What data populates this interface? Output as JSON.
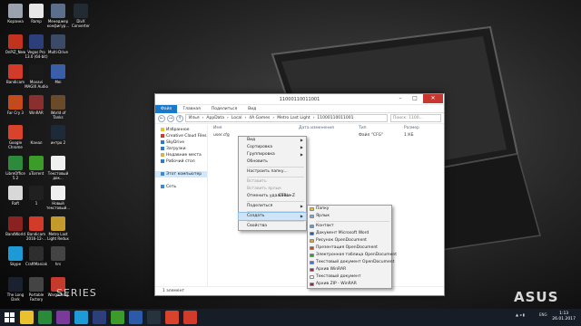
{
  "desktop": {
    "icons": [
      {
        "label": "Корзина",
        "color": "#9aa3ad"
      },
      {
        "label": "Ramp",
        "color": "#e7e7e7"
      },
      {
        "label": "Менеджер конфигур...",
        "color": "#5b6e8a"
      },
      {
        "label": "DivX Converter",
        "color": "#222a33"
      },
      {
        "label": "OnPiZ_New",
        "color": "#c2331f"
      },
      {
        "label": "Vegas Pro 13.0 (64-bit)",
        "color": "#2c3f7a"
      },
      {
        "label": "Multi-Drive",
        "color": "#3b4a66"
      },
      {
        "label": "Bandicam",
        "color": "#d23a2a"
      },
      {
        "label": "Movavi MAGIX Audio",
        "color": "#1a1a1a"
      },
      {
        "label": "Mei",
        "color": "#3a5ea8"
      },
      {
        "label": "Far Cry 3",
        "color": "#c24a1b"
      },
      {
        "label": "WinRAR",
        "color": "#8a2f2f"
      },
      {
        "label": "World of Tanks",
        "color": "#6a4a2a"
      },
      {
        "label": "Google Chrome",
        "color": "#d9432b"
      },
      {
        "label": "Канал",
        "color": "#1a1a1a"
      },
      {
        "label": "интро 2",
        "color": "#1f2a38"
      },
      {
        "label": "LibreOffice 5.2",
        "color": "#2d8a3c"
      },
      {
        "label": "uTorrent",
        "color": "#3b9c2a"
      },
      {
        "label": "Текстовый док...",
        "color": "#f0f0f0"
      },
      {
        "label": "Raft",
        "color": "#d8d8d8"
      },
      {
        "label": "1",
        "color": "#202020"
      },
      {
        "label": "Новый текстовый...",
        "color": "#f0f0f0"
      },
      {
        "label": "Bandicam 2016-12-...",
        "color": "#d23a2a"
      },
      {
        "label": "Metro Last Light Redux",
        "color": "#c49a2c"
      },
      {
        "label": "BandWorld",
        "color": "#8a2222"
      },
      {
        "label": "Skype",
        "color": "#1e9ad6"
      },
      {
        "label": "CraftManiak",
        "color": "#2e2e2e"
      },
      {
        "label": "hrs",
        "color": "#444"
      },
      {
        "label": "The Long Dark",
        "color": "#1a2230"
      },
      {
        "label": "Portable Factory",
        "color": "#444"
      },
      {
        "label": "Wargaming",
        "color": "#c43b2b"
      }
    ],
    "brand": "ASUS",
    "series": "SERIES"
  },
  "explorer": {
    "title": "11000110011001",
    "ribbon_tabs": [
      "Файл",
      "Главная",
      "Поделиться",
      "Вид"
    ],
    "nav": {
      "back": "←",
      "forward": "→",
      "up": "↑"
    },
    "path": [
      "Илья",
      "AppData",
      "Local",
      "4A Games",
      "Metro Last Light",
      "11000110011001"
    ],
    "search_placeholder": "Поиск: 1100...",
    "sidebar": [
      {
        "label": "Избранное",
        "color": "#e8c12c"
      },
      {
        "label": "Creative Cloud Files",
        "color": "#d03a2c"
      },
      {
        "label": "SkyDrive",
        "color": "#2b7bd0"
      },
      {
        "label": "Загрузки",
        "color": "#2b7bd0"
      },
      {
        "label": "Недавние места",
        "color": "#d6b24a"
      },
      {
        "label": "Рабочий стол",
        "color": "#2b7bd0"
      },
      {
        "label": "",
        "color": ""
      },
      {
        "label": "Этот компьютер",
        "color": "#3b8ad8"
      },
      {
        "label": "",
        "color": ""
      },
      {
        "label": "Сеть",
        "color": "#3b8ad8"
      }
    ],
    "columns": [
      "Имя",
      "Дата изменения",
      "Тип",
      "Размер"
    ],
    "files": [
      {
        "name": "user.cfg",
        "date": "",
        "type": "Файл \"CFG\"",
        "size": "1 КБ"
      }
    ],
    "status": "1 элемент"
  },
  "context_menu": {
    "items": [
      {
        "label": "Вид",
        "arrow": true
      },
      {
        "label": "Сортировка",
        "arrow": true
      },
      {
        "label": "Группировка",
        "arrow": true
      },
      {
        "label": "Обновить"
      },
      {
        "sep": true
      },
      {
        "label": "Настроить папку..."
      },
      {
        "sep": true
      },
      {
        "label": "Вставить",
        "disabled": true
      },
      {
        "label": "Вставить ярлык",
        "disabled": true
      },
      {
        "label": "Отменить удаление",
        "shortcut": "CTRL+Z"
      },
      {
        "sep": true
      },
      {
        "label": "Поделиться",
        "arrow": true
      },
      {
        "sep": true
      },
      {
        "label": "Создать",
        "arrow": true,
        "highlight": true
      },
      {
        "sep": true
      },
      {
        "label": "Свойства"
      }
    ]
  },
  "submenu": {
    "items": [
      {
        "label": "Папку",
        "icon": "#e8c12c"
      },
      {
        "label": "Ярлык",
        "icon": "#7fa6cf"
      },
      {
        "sep": true
      },
      {
        "label": "Контакт",
        "icon": "#5aa0d6"
      },
      {
        "label": "Документ Microsoft Word",
        "icon": "#2b5aa8"
      },
      {
        "label": "Рисунок OpenDocument",
        "icon": "#d6a73a"
      },
      {
        "label": "Презентация OpenDocument",
        "icon": "#c44a2c"
      },
      {
        "label": "Электронная таблица OpenDocument",
        "icon": "#3a9a3a"
      },
      {
        "label": "Текстовый документ OpenDocument",
        "icon": "#3a7ad6"
      },
      {
        "label": "Архив WinRAR",
        "icon": "#8a2f5a"
      },
      {
        "label": "Текстовый документ",
        "icon": "#f4f4f4"
      },
      {
        "label": "Архив ZIP - WinRAR",
        "icon": "#8a2f5a"
      }
    ]
  },
  "taskbar": {
    "apps": [
      {
        "name": "explorer",
        "color": "#e8c12c"
      },
      {
        "name": "excel",
        "color": "#2a8a3a"
      },
      {
        "name": "media",
        "color": "#7a3a9a"
      },
      {
        "name": "skype",
        "color": "#1e9ad6"
      },
      {
        "name": "vegas",
        "color": "#2c3f7a"
      },
      {
        "name": "utorrent",
        "color": "#3b9c2a"
      },
      {
        "name": "word",
        "color": "#2b5aa8"
      },
      {
        "name": "steam",
        "color": "#27323f"
      },
      {
        "name": "chrome",
        "color": "#d9432b"
      },
      {
        "name": "bandicam",
        "color": "#d23a2a"
      }
    ],
    "lang": "ENG",
    "time": "1:13",
    "date": "26.01.2017"
  },
  "colors": {
    "accent": "#1979ca",
    "close": "#c7372f"
  }
}
